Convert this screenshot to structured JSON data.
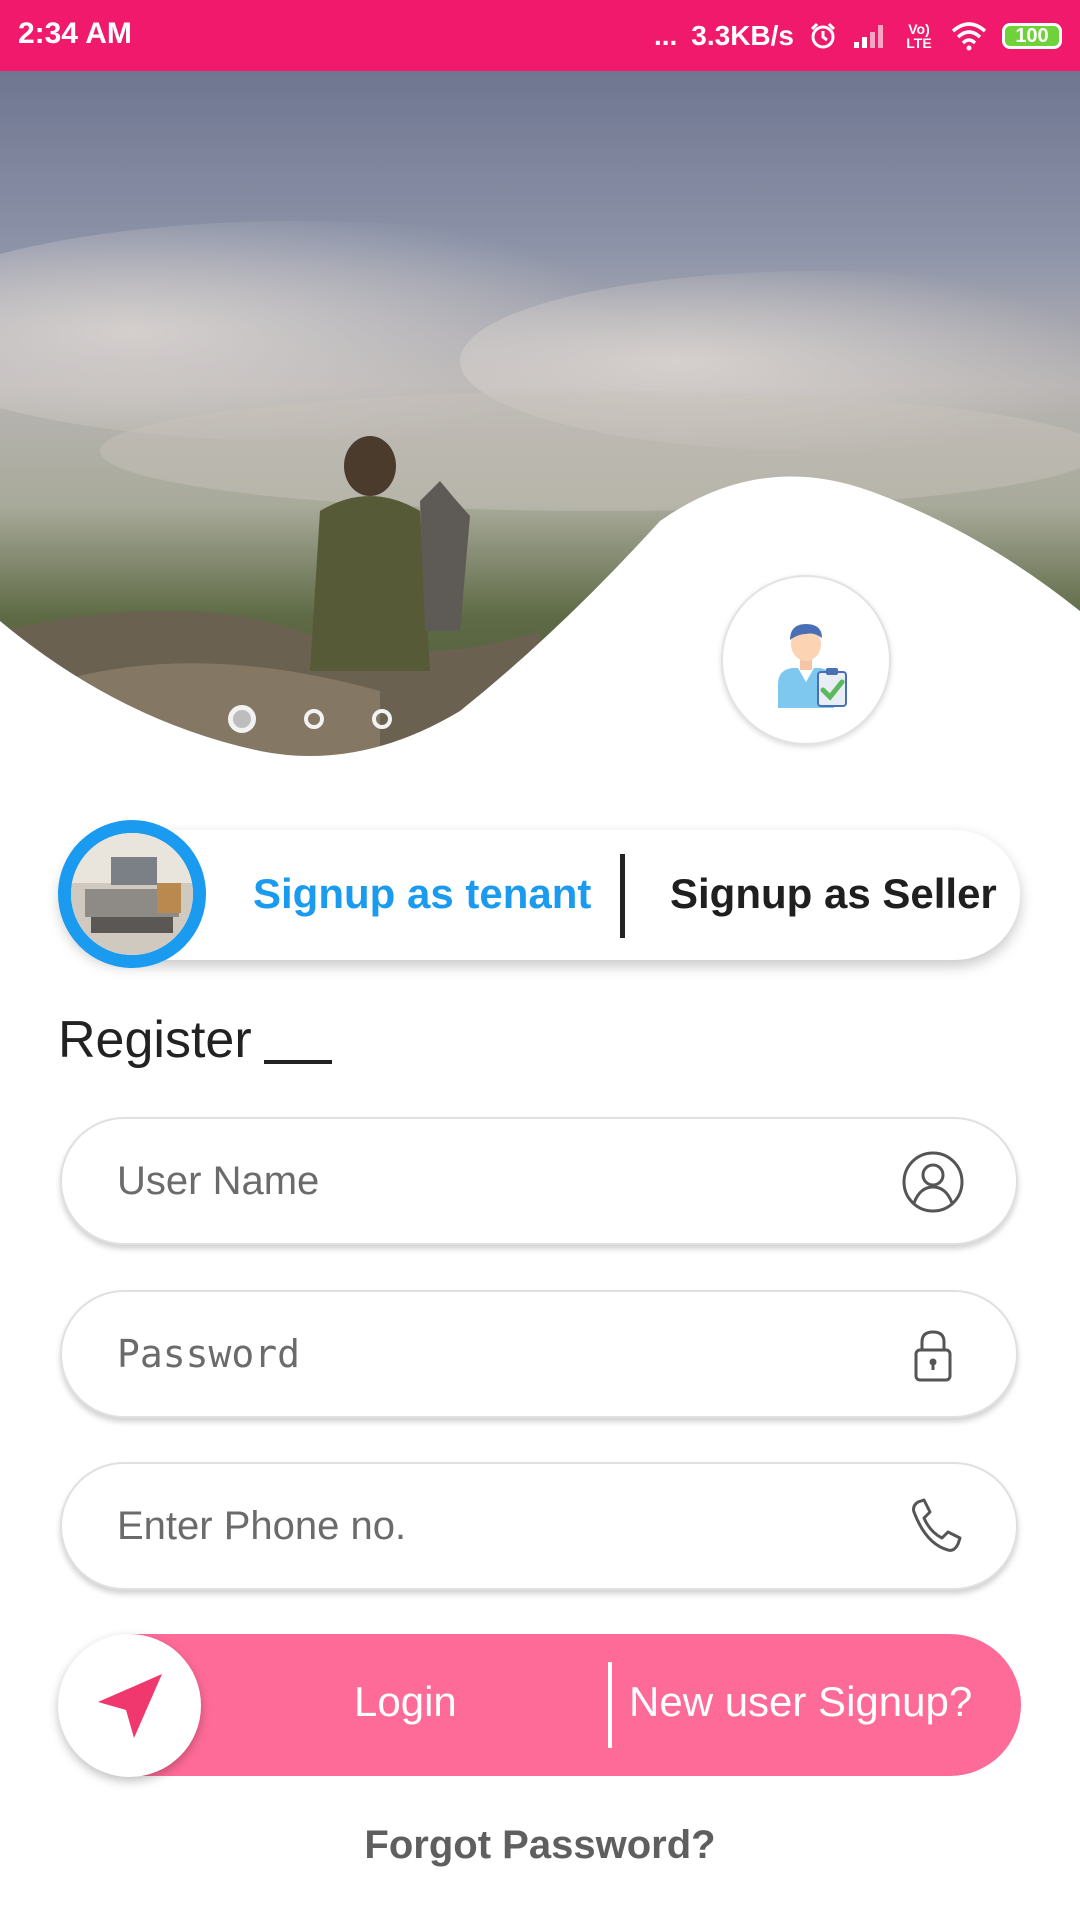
{
  "status_bar": {
    "time": "2:34 AM",
    "dots": "...",
    "net_speed": "3.3KB/s",
    "network_label": "Vo) LTE",
    "battery": "100",
    "icons": [
      "alarm-icon",
      "signal-icon",
      "volte-icon",
      "wifi-icon",
      "battery-icon"
    ]
  },
  "hero": {
    "carousel_dot_count": 3,
    "active_dot": 0,
    "badge_icon": "user-clipboard-icon"
  },
  "signup_toggle": {
    "tenant_label": "Signup as tenant",
    "seller_label": "Signup as Seller",
    "active": "tenant",
    "active_color": "#1a9bf0"
  },
  "form": {
    "title": "Register",
    "fields": {
      "username": {
        "placeholder": "User Name",
        "icon": "user-icon"
      },
      "password": {
        "placeholder": "Password",
        "icon": "lock-icon"
      },
      "phone": {
        "placeholder": "Enter Phone no.",
        "icon": "phone-icon"
      }
    }
  },
  "actions": {
    "login_label": "Login",
    "signup_label": "New user Signup?",
    "nav_icon": "navigation-arrow-icon",
    "accent_color": "#ff6b98"
  },
  "forgot_label": "Forgot Password?",
  "colors": {
    "status_bar": "#f0196b",
    "primary_blue": "#1a9bf0",
    "pink": "#ff6b98"
  }
}
